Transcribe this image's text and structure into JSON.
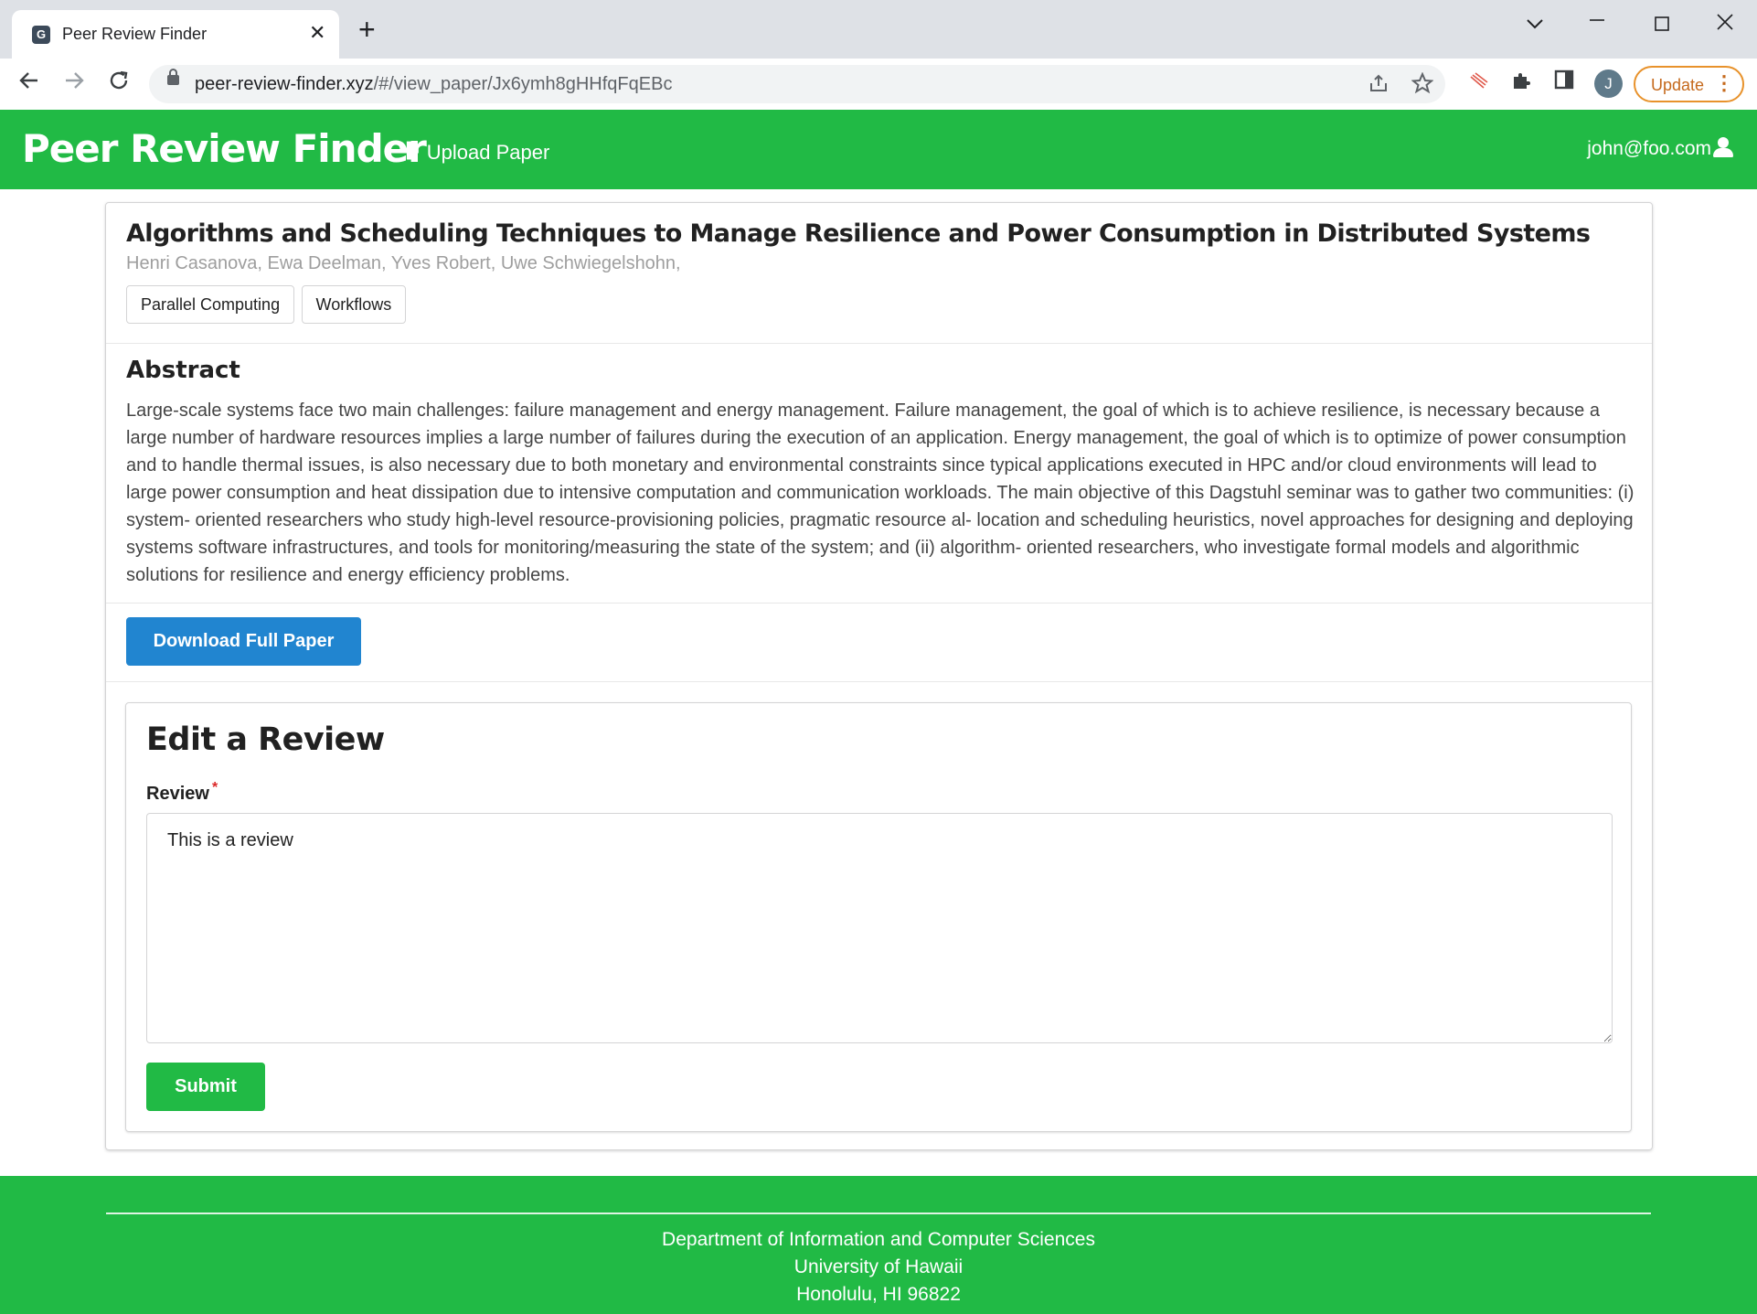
{
  "browser": {
    "tab_title": "Peer Review Finder",
    "url_host": "peer-review-finder.xyz",
    "url_path": "/#/view_paper/Jx6ymh8gHHfqFqEBc",
    "profile_initial": "J",
    "update_label": "Update"
  },
  "header": {
    "brand": "Peer Review Finder",
    "upload_label": "Upload Paper",
    "user_email": "john@foo.com"
  },
  "paper": {
    "title": "Algorithms and Scheduling Techniques to Manage Resilience and Power Consumption in Distributed Systems",
    "authors": "Henri Casanova, Ewa Deelman, Yves Robert, Uwe Schwiegelshohn,",
    "tags": [
      "Parallel Computing",
      "Workflows"
    ],
    "abstract_heading": "Abstract",
    "abstract": "Large-scale systems face two main challenges: failure management and energy management. Failure management, the goal of which is to achieve resilience, is necessary because a large number of hardware resources implies a large number of failures during the execution of an application. Energy management, the goal of which is to optimize of power consumption and to handle thermal issues, is also necessary due to both monetary and environmental constraints since typical applications executed in HPC and/or cloud environments will lead to large power consumption and heat dissipation due to intensive computation and communication workloads. The main objective of this Dagstuhl seminar was to gather two communities: (i) system- oriented researchers who study high-level resource-provisioning policies, pragmatic resource al- location and scheduling heuristics, novel approaches for designing and deploying systems software infrastructures, and tools for monitoring/measuring the state of the system; and (ii) algorithm- oriented researchers, who investigate formal models and algorithmic solutions for resilience and energy efficiency problems.",
    "download_label": "Download Full Paper"
  },
  "review_form": {
    "heading": "Edit a Review",
    "field_label": "Review",
    "required_mark": "*",
    "value": "This is a review",
    "submit_label": "Submit"
  },
  "footer": {
    "line1": "Department of Information and Computer Sciences",
    "line2": "University of Hawaii",
    "line3": "Honolulu, HI 96822"
  },
  "colors": {
    "brand_green": "#21ba45",
    "download_blue": "#2185d0",
    "required_red": "#db2828"
  },
  "icons": [
    "app-favicon",
    "tab-close-icon",
    "new-tab-icon",
    "chevron-down-icon",
    "minimize-icon",
    "maximize-icon",
    "window-close-icon",
    "back-icon",
    "forward-icon",
    "reload-icon",
    "lock-icon",
    "share-icon",
    "star-icon",
    "extension-icon",
    "puzzle-icon",
    "sidepanel-icon",
    "kebab-menu-icon",
    "plus-icon",
    "user-icon"
  ]
}
